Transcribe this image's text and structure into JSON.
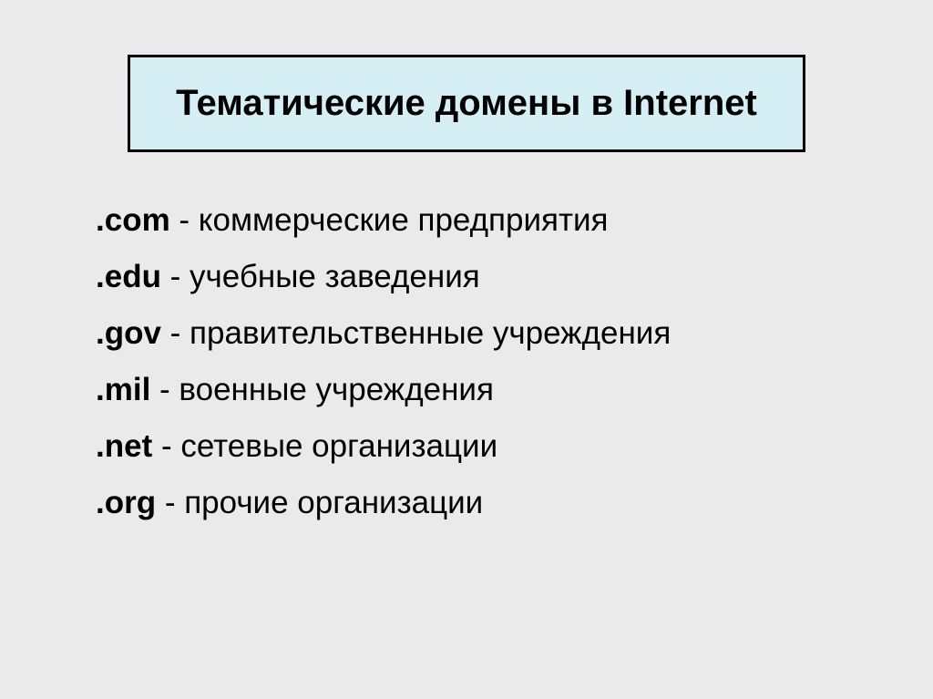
{
  "title": "Тематические домены в Internet",
  "domains": [
    {
      "code": ".com",
      "description": " - коммерческие предприятия"
    },
    {
      "code": ".edu",
      "description": " - учебные заведения"
    },
    {
      "code": ".gov",
      "description": " - правительственные учреждения"
    },
    {
      "code": ".mil",
      "description": " - военные учреждения"
    },
    {
      "code": ".net",
      "description": " - сетевые организации"
    },
    {
      "code": ".org",
      "description": " - прочие организации"
    }
  ]
}
